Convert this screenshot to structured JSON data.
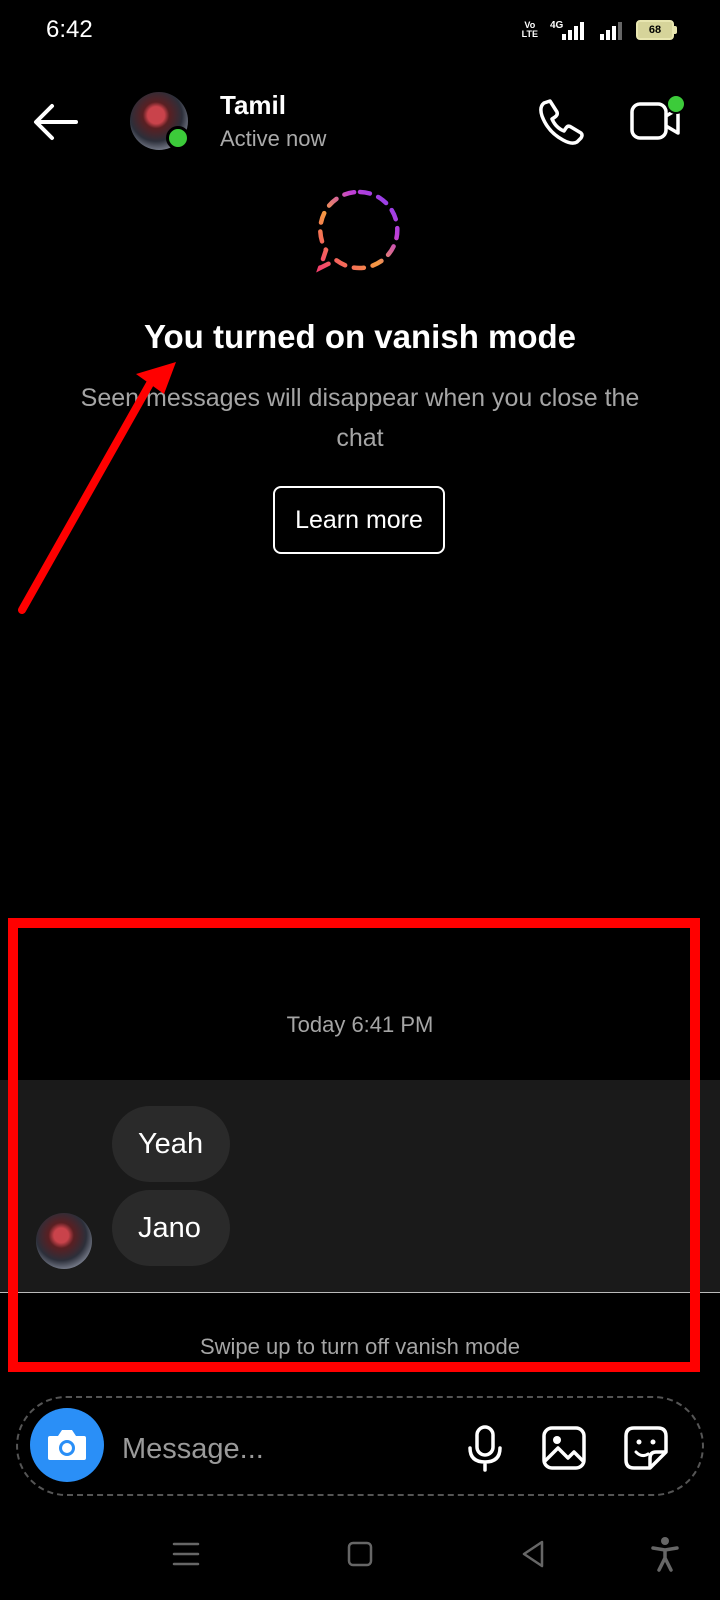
{
  "status_bar": {
    "time": "6:42",
    "network_label": "Vo\nLTE",
    "signal_label": "4G",
    "battery": "68"
  },
  "header": {
    "contact_name": "Tamil",
    "contact_status": "Active now"
  },
  "vanish": {
    "title": "You turned on vanish mode",
    "description": "Seen messages will disappear when you close the chat",
    "learn_more": "Learn more"
  },
  "chat": {
    "timestamp": "Today 6:41 PM",
    "messages": [
      {
        "text": "Yeah"
      },
      {
        "text": "Jano"
      }
    ],
    "swipe_hint": "Swipe up to turn off vanish mode"
  },
  "composer": {
    "placeholder": "Message..."
  },
  "colors": {
    "accent": "#2a8ff7",
    "online": "#3ccb3a",
    "annotation": "#ff0000",
    "background": "#000000"
  },
  "icons": [
    "back-arrow-icon",
    "phone-icon",
    "video-icon",
    "vanish-mode-icon",
    "camera-icon",
    "microphone-icon",
    "gallery-icon",
    "sticker-icon",
    "menu-icon",
    "home-icon",
    "back-triangle-icon",
    "accessibility-icon"
  ]
}
